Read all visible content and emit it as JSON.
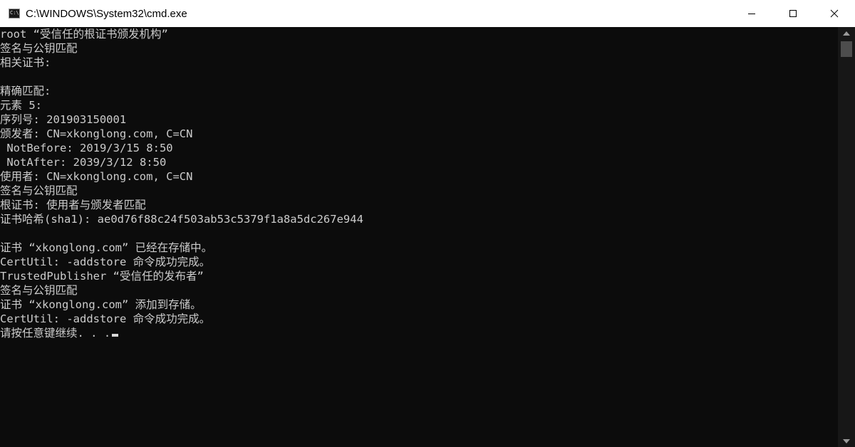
{
  "window": {
    "title": "C:\\WINDOWS\\System32\\cmd.exe",
    "icon_prompt": "C:\\"
  },
  "console": {
    "lines": [
      "root “受信任的根证书颁发机构”",
      "签名与公钥匹配",
      "相关证书:",
      "",
      "精确匹配:",
      "元素 5:",
      "序列号: 201903150001",
      "颁发者: CN=xkonglong.com, C=CN",
      " NotBefore: 2019/3/15 8:50",
      " NotAfter: 2039/3/12 8:50",
      "使用者: CN=xkonglong.com, C=CN",
      "签名与公钥匹配",
      "根证书: 使用者与颁发者匹配",
      "证书哈希(sha1): ae0d76f88c24f503ab53c5379f1a8a5dc267e944",
      "",
      "证书 “xkonglong.com” 已经在存储中。",
      "CertUtil: -addstore 命令成功完成。",
      "TrustedPublisher “受信任的发布者”",
      "签名与公钥匹配",
      "证书 “xkonglong.com” 添加到存储。",
      "CertUtil: -addstore 命令成功完成。",
      "请按任意键继续. . ."
    ]
  },
  "colors": {
    "console_background": "#0c0c0c",
    "console_text": "#cccccc",
    "titlebar_background": "#ffffff"
  },
  "icons": {
    "app": "cmd-icon",
    "minimize": "minimize-icon",
    "maximize": "maximize-icon",
    "close": "close-icon",
    "scroll_up": "scroll-up-arrow-icon",
    "scroll_down": "scroll-down-arrow-icon"
  }
}
